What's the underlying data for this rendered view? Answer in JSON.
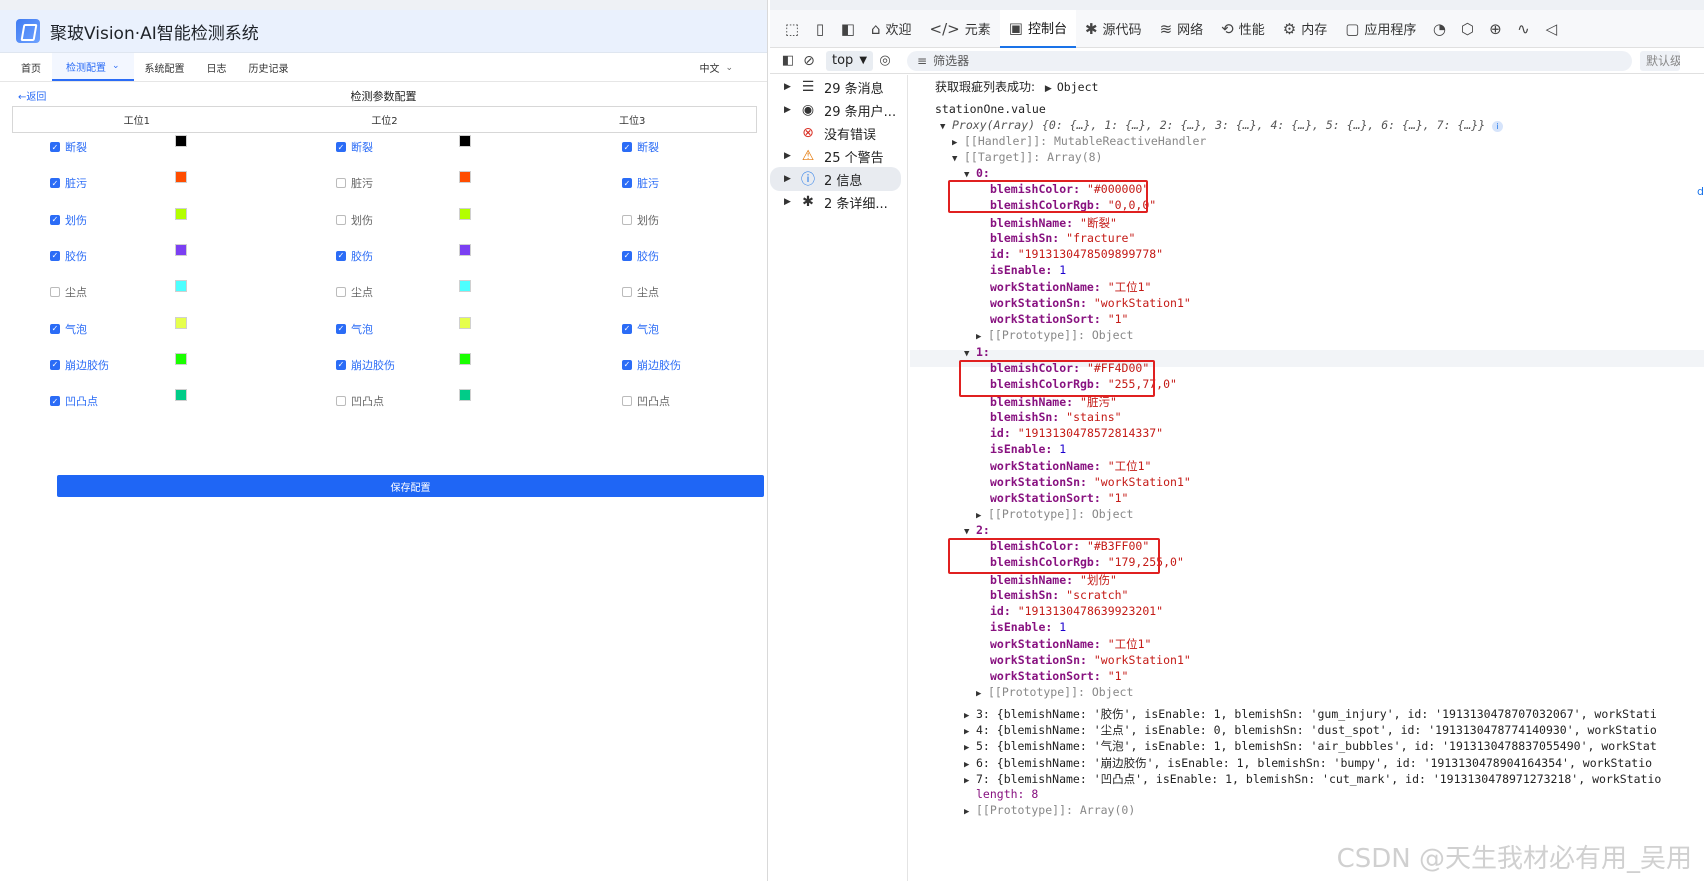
{
  "app": {
    "title": "聚玻Vision·AI智能检测系统",
    "nav": [
      "首页",
      "检测配置",
      "系统配置",
      "日志",
      "历史记录"
    ],
    "nav_active": 1,
    "language": "中文",
    "back": "返回",
    "page_title": "检测参数配置",
    "stations": [
      "工位1",
      "工位2",
      "工位3"
    ],
    "defects": [
      {
        "name": "断裂",
        "color": "#000000",
        "enabled": [
          true,
          true,
          true
        ]
      },
      {
        "name": "脏污",
        "color": "#FF4D00",
        "enabled": [
          true,
          false,
          true
        ]
      },
      {
        "name": "划伤",
        "color": "#B3FF00",
        "enabled": [
          true,
          false,
          false
        ]
      },
      {
        "name": "胶伤",
        "color": "#7B3FF2",
        "enabled": [
          true,
          true,
          true
        ]
      },
      {
        "name": "尘点",
        "color": "#4DFFFF",
        "enabled": [
          false,
          false,
          false
        ]
      },
      {
        "name": "气泡",
        "color": "#E6FF4D",
        "enabled": [
          true,
          true,
          true
        ]
      },
      {
        "name": "崩边胶伤",
        "color": "#1AFF00",
        "enabled": [
          true,
          true,
          true
        ]
      },
      {
        "name": "凹凸点",
        "color": "#00CC88",
        "enabled": [
          true,
          false,
          false
        ]
      }
    ],
    "save_label": "保存配置"
  },
  "devtools": {
    "tabs": [
      {
        "icon": "home-icon",
        "glyph": "⌂",
        "label": "欢迎"
      },
      {
        "icon": "code-icon",
        "glyph": "</>",
        "label": "元素"
      },
      {
        "icon": "console-icon",
        "glyph": "▣",
        "label": "控制台"
      },
      {
        "icon": "bug-icon",
        "glyph": "✱",
        "label": "源代码"
      },
      {
        "icon": "wifi-icon",
        "glyph": "≋",
        "label": "网络"
      },
      {
        "icon": "performance-icon",
        "glyph": "⟲",
        "label": "性能"
      },
      {
        "icon": "memory-icon",
        "glyph": "⚙",
        "label": "内存"
      },
      {
        "icon": "application-icon",
        "glyph": "▢",
        "label": "应用程序"
      }
    ],
    "active_tab": 2,
    "context": "top",
    "filter_placeholder": "筛选器",
    "default_levels": "默认级",
    "sidebar": [
      {
        "icon": "list-icon",
        "glyph": "☰",
        "label": "29 条消息",
        "expandable": true
      },
      {
        "icon": "user-icon",
        "glyph": "◉",
        "label": "29 条用户...",
        "expandable": true
      },
      {
        "icon": "error-icon",
        "glyph": "⊗",
        "label": "没有错误",
        "expandable": false
      },
      {
        "icon": "warning-icon",
        "glyph": "⚠",
        "label": "25 个警告",
        "expandable": true
      },
      {
        "icon": "info-icon",
        "glyph": "ⓘ",
        "label": "2 信息",
        "expandable": true
      },
      {
        "icon": "bug-icon",
        "glyph": "✱",
        "label": "2 条详细...",
        "expandable": true
      }
    ],
    "console": {
      "log1_text": "获取瑕疵列表成功:",
      "log1_obj": "Object",
      "log2": "stationOne.value",
      "source_link": "d",
      "proxy_head": "Proxy(Array) {0: {…}, 1: {…}, 2: {…}, 3: {…}, 4: {…}, 5: {…}, 6: {…}, 7: {…}}",
      "handler": "[[Handler]]: MutableReactiveHandler",
      "target": "[[Target]]: Array(8)",
      "prototype_obj": "[[Prototype]]: Object",
      "items": [
        {
          "index": "0:",
          "blemishColor": "\"#000000\"",
          "blemishColorRgb": "\"0,0,0\"",
          "blemishName": "\"断裂\"",
          "blemishSn": "\"fracture\"",
          "id": "\"1913130478509899778\"",
          "isEnable": "1",
          "workStationName": "\"工位1\"",
          "workStationSn": "\"workStation1\"",
          "workStationSort": "\"1\""
        },
        {
          "index": "1:",
          "blemishColor": "\"#FF4D00\"",
          "blemishColorRgb": "\"255,77,0\"",
          "blemishName": "\"脏污\"",
          "blemishSn": "\"stains\"",
          "id": "\"1913130478572814337\"",
          "isEnable": "1",
          "workStationName": "\"工位1\"",
          "workStationSn": "\"workStation1\"",
          "workStationSort": "\"1\""
        },
        {
          "index": "2:",
          "blemishColor": "\"#B3FF00\"",
          "blemishColorRgb": "\"179,255,0\"",
          "blemishName": "\"划伤\"",
          "blemishSn": "\"scratch\"",
          "id": "\"1913130478639923201\"",
          "isEnable": "1",
          "workStationName": "\"工位1\"",
          "workStationSn": "\"workStation1\"",
          "workStationSort": "\"1\""
        }
      ],
      "collapsed": [
        "3: {blemishName: '胶伤', isEnable: 1, blemishSn: 'gum_injury', id: '1913130478707032067', workStati",
        "4: {blemishName: '尘点', isEnable: 0, blemishSn: 'dust_spot', id: '1913130478774140930', workStatio",
        "5: {blemishName: '气泡', isEnable: 1, blemishSn: 'air_bubbles', id: '1913130478837055490', workStat",
        "6: {blemishName: '崩边胶伤', isEnable: 1, blemishSn: 'bumpy', id: '1913130478904164354', workStatio",
        "7: {blemishName: '凹凸点', isEnable: 1, blemishSn: 'cut_mark', id: '1913130478971273218', workStatio"
      ],
      "length": "length: 8",
      "prototype_arr": "[[Prototype]]: Array(0)"
    },
    "watermark": "CSDN @天生我材必有用_吴用"
  }
}
